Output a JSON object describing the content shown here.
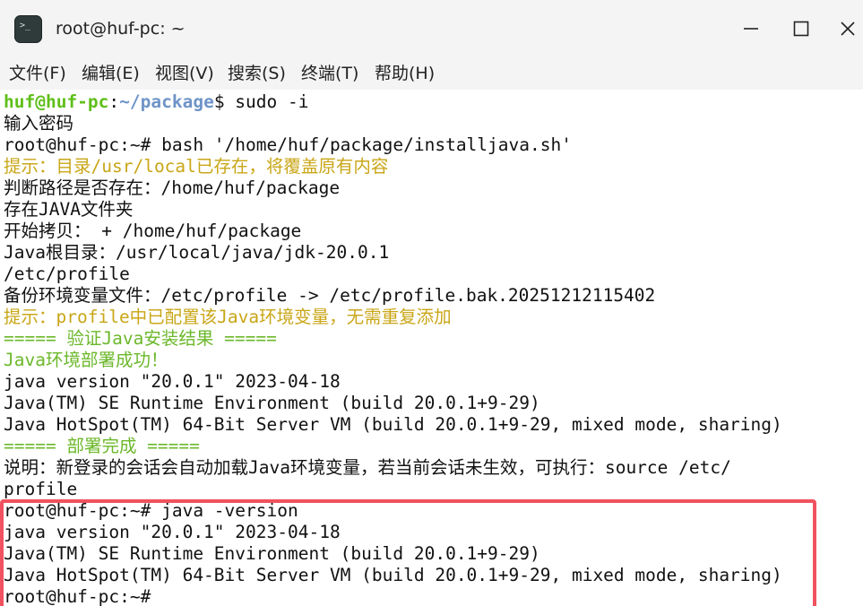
{
  "window": {
    "title": "root@huf-pc: ~",
    "app_icon": "terminal-icon",
    "app_icon_glyph": ">_",
    "controls": [
      "minimize-icon",
      "maximize-icon",
      "close-icon"
    ]
  },
  "menu": [
    {
      "label": "文件(F)"
    },
    {
      "label": "编辑(E)"
    },
    {
      "label": "视图(V)"
    },
    {
      "label": "搜索(S)"
    },
    {
      "label": "终端(T)"
    },
    {
      "label": "帮助(H)"
    }
  ],
  "colors": {
    "prompt_user": "#5fbf1a",
    "prompt_path": "#6e94c8",
    "hint": "#c9a617",
    "success": "#6cb82b",
    "highlight_border": "#f0525f"
  },
  "terminal": {
    "lines": [
      {
        "segments": [
          {
            "text": "huf@huf-pc",
            "style": "green"
          },
          {
            "text": ":",
            "style": "black"
          },
          {
            "text": "~/package",
            "style": "blue"
          },
          {
            "text": "$ sudo -i",
            "style": "black"
          }
        ]
      },
      {
        "segments": [
          {
            "text": "输入密码",
            "style": "black"
          }
        ]
      },
      {
        "segments": [
          {
            "text": "root@huf-pc:~# bash '/home/huf/package/installjava.sh'",
            "style": "black"
          }
        ]
      },
      {
        "segments": [
          {
            "text": "提示：目录/usr/local已存在，将覆盖原有内容",
            "style": "yellow"
          }
        ]
      },
      {
        "segments": [
          {
            "text": "判断路径是否存在：/home/huf/package",
            "style": "black"
          }
        ]
      },
      {
        "segments": [
          {
            "text": "存在JAVA文件夹",
            "style": "black"
          }
        ]
      },
      {
        "segments": [
          {
            "text": "开始拷贝： + /home/huf/package",
            "style": "black"
          }
        ]
      },
      {
        "segments": [
          {
            "text": "Java根目录：/usr/local/java/jdk-20.0.1",
            "style": "black"
          }
        ]
      },
      {
        "segments": [
          {
            "text": "/etc/profile",
            "style": "black"
          }
        ]
      },
      {
        "segments": [
          {
            "text": "备份环境变量文件：/etc/profile -> /etc/profile.bak.20251212115402",
            "style": "black"
          }
        ]
      },
      {
        "segments": [
          {
            "text": "提示：profile中已配置该Java环境变量，无需重复添加",
            "style": "yellow"
          }
        ]
      },
      {
        "segments": [
          {
            "text": "===== 验证Java安装结果 =====",
            "style": "lgreen"
          }
        ]
      },
      {
        "segments": [
          {
            "text": "Java环境部署成功！",
            "style": "lgreen"
          }
        ]
      },
      {
        "segments": [
          {
            "text": "java version \"20.0.1\" 2023-04-18",
            "style": "black"
          }
        ]
      },
      {
        "segments": [
          {
            "text": "Java(TM) SE Runtime Environment (build 20.0.1+9-29)",
            "style": "black"
          }
        ]
      },
      {
        "segments": [
          {
            "text": "Java HotSpot(TM) 64-Bit Server VM (build 20.0.1+9-29, mixed mode, sharing)",
            "style": "black"
          }
        ]
      },
      {
        "segments": [
          {
            "text": "===== 部署完成 =====",
            "style": "lgreen"
          }
        ]
      },
      {
        "segments": [
          {
            "text": "说明：新登录的会话会自动加载Java环境变量，若当前会话未生效，可执行：source /etc/",
            "style": "black"
          }
        ]
      },
      {
        "segments": [
          {
            "text": "profile",
            "style": "black"
          }
        ]
      },
      {
        "segments": [
          {
            "text": "root@huf-pc:~# java -version",
            "style": "black"
          }
        ]
      },
      {
        "segments": [
          {
            "text": "java version \"20.0.1\" 2023-04-18",
            "style": "black"
          }
        ]
      },
      {
        "segments": [
          {
            "text": "Java(TM) SE Runtime Environment (build 20.0.1+9-29)",
            "style": "black"
          }
        ]
      },
      {
        "segments": [
          {
            "text": "Java HotSpot(TM) 64-Bit Server VM (build 20.0.1+9-29, mixed mode, sharing)",
            "style": "black"
          }
        ]
      },
      {
        "segments": [
          {
            "text": "root@huf-pc:~# ",
            "style": "black"
          }
        ]
      }
    ]
  }
}
